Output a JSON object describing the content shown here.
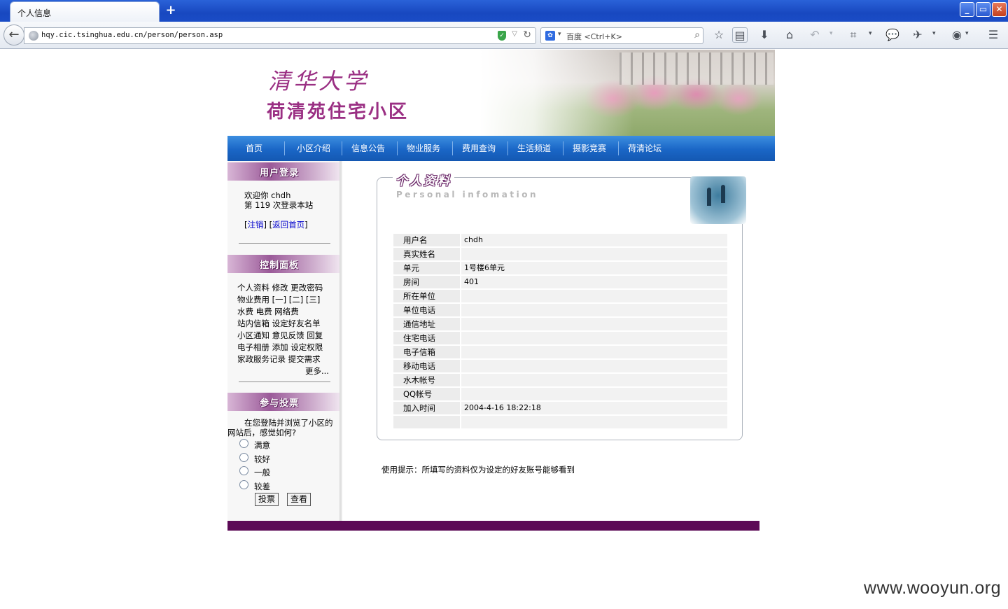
{
  "browser": {
    "tab_title": "个人信息",
    "new_tab": "+",
    "url": "hqy.cic.tsinghua.edu.cn/person/person.asp",
    "search_placeholder": "百度 <Ctrl+K>"
  },
  "site": {
    "logo_line1": "清华大学",
    "logo_line2": "荷清苑住宅小区",
    "menu": [
      "首页",
      "小区介绍",
      "信息公告",
      "物业服务",
      "费用查询",
      "生活频道",
      "摄影竞赛",
      "荷清论坛"
    ]
  },
  "sidebar": {
    "login": {
      "title": "用户登录",
      "welcome": "欢迎你  chdh",
      "count": "第 119 次登录本站",
      "bracket_open": "[",
      "logout": "注销",
      "bracket_mid": "]  [",
      "home": "返回首页",
      "bracket_close": "]"
    },
    "panel": {
      "title": "控制面板",
      "lines": [
        "个人资料  修改  更改密码",
        "物业费用  [一] [二] [三]",
        "水费  电费  网络费",
        "站内信箱  设定好友名单",
        "小区通知  意见反馈  回复",
        "电子相册  添加  设定权限",
        "家政服务记录  提交需求"
      ],
      "more": "更多..."
    },
    "vote": {
      "title": "参与投票",
      "question_line1": "在您登陆并浏览了小区的",
      "question_line2": "网站后，感觉如何?",
      "options": [
        "满意",
        "较好",
        "一般",
        "较差"
      ],
      "vote_button": "投票",
      "view_button": "查看"
    }
  },
  "profile": {
    "title": "个人资料",
    "subtitle": "Personal infomation",
    "rows": [
      {
        "label": "用户名",
        "value": "chdh"
      },
      {
        "label": "真实姓名",
        "value": ""
      },
      {
        "label": "单元",
        "value": "1号楼6单元"
      },
      {
        "label": "房间",
        "value": "401"
      },
      {
        "label": "所在单位",
        "value": ""
      },
      {
        "label": "单位电话",
        "value": ""
      },
      {
        "label": "通信地址",
        "value": ""
      },
      {
        "label": "住宅电话",
        "value": ""
      },
      {
        "label": "电子信箱",
        "value": ""
      },
      {
        "label": "移动电话",
        "value": ""
      },
      {
        "label": "水木帐号",
        "value": ""
      },
      {
        "label": "QQ帐号",
        "value": ""
      },
      {
        "label": "加入时间",
        "value": "2004-4-16 18:22:18"
      },
      {
        "label": "",
        "value": ""
      }
    ]
  },
  "hint": "使用提示：所填写的资料仅为设定的好友账号能够看到",
  "watermark": "www.wooyun.org",
  "colors": {
    "menu_blue": "#1a66c6",
    "brand_purple": "#9a2f83",
    "footer_purple": "#5c0a56",
    "link_blue": "#0000cc"
  }
}
